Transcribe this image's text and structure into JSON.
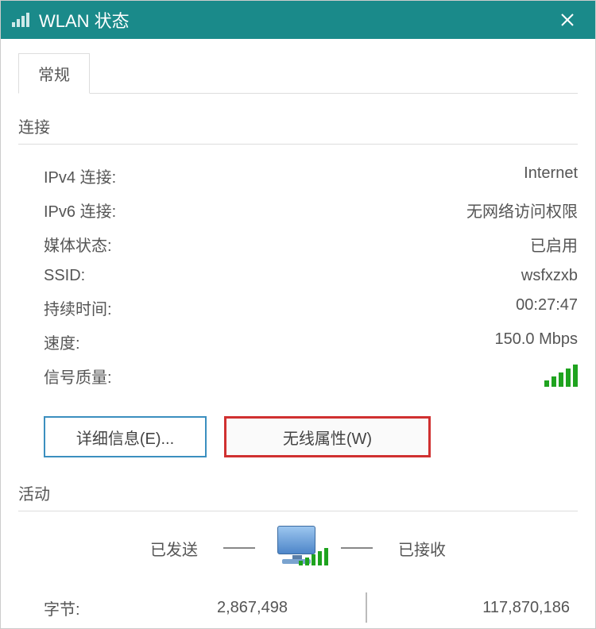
{
  "titlebar": {
    "title": "WLAN 状态"
  },
  "tabs": {
    "general": "常规"
  },
  "connection": {
    "section_label": "连接",
    "ipv4_label": "IPv4 连接:",
    "ipv4_value": "Internet",
    "ipv6_label": "IPv6 连接:",
    "ipv6_value": "无网络访问权限",
    "media_label": "媒体状态:",
    "media_value": "已启用",
    "ssid_label": "SSID:",
    "ssid_value": "wsfxzxb",
    "duration_label": "持续时间:",
    "duration_value": "00:27:47",
    "speed_label": "速度:",
    "speed_value": "150.0 Mbps",
    "signal_label": "信号质量:"
  },
  "buttons": {
    "details": "详细信息(E)...",
    "wireless": "无线属性(W)"
  },
  "activity": {
    "section_label": "活动",
    "sent_label": "已发送",
    "received_label": "已接收",
    "bytes_label": "字节:",
    "bytes_sent": "2,867,498",
    "bytes_received": "117,870,186"
  }
}
